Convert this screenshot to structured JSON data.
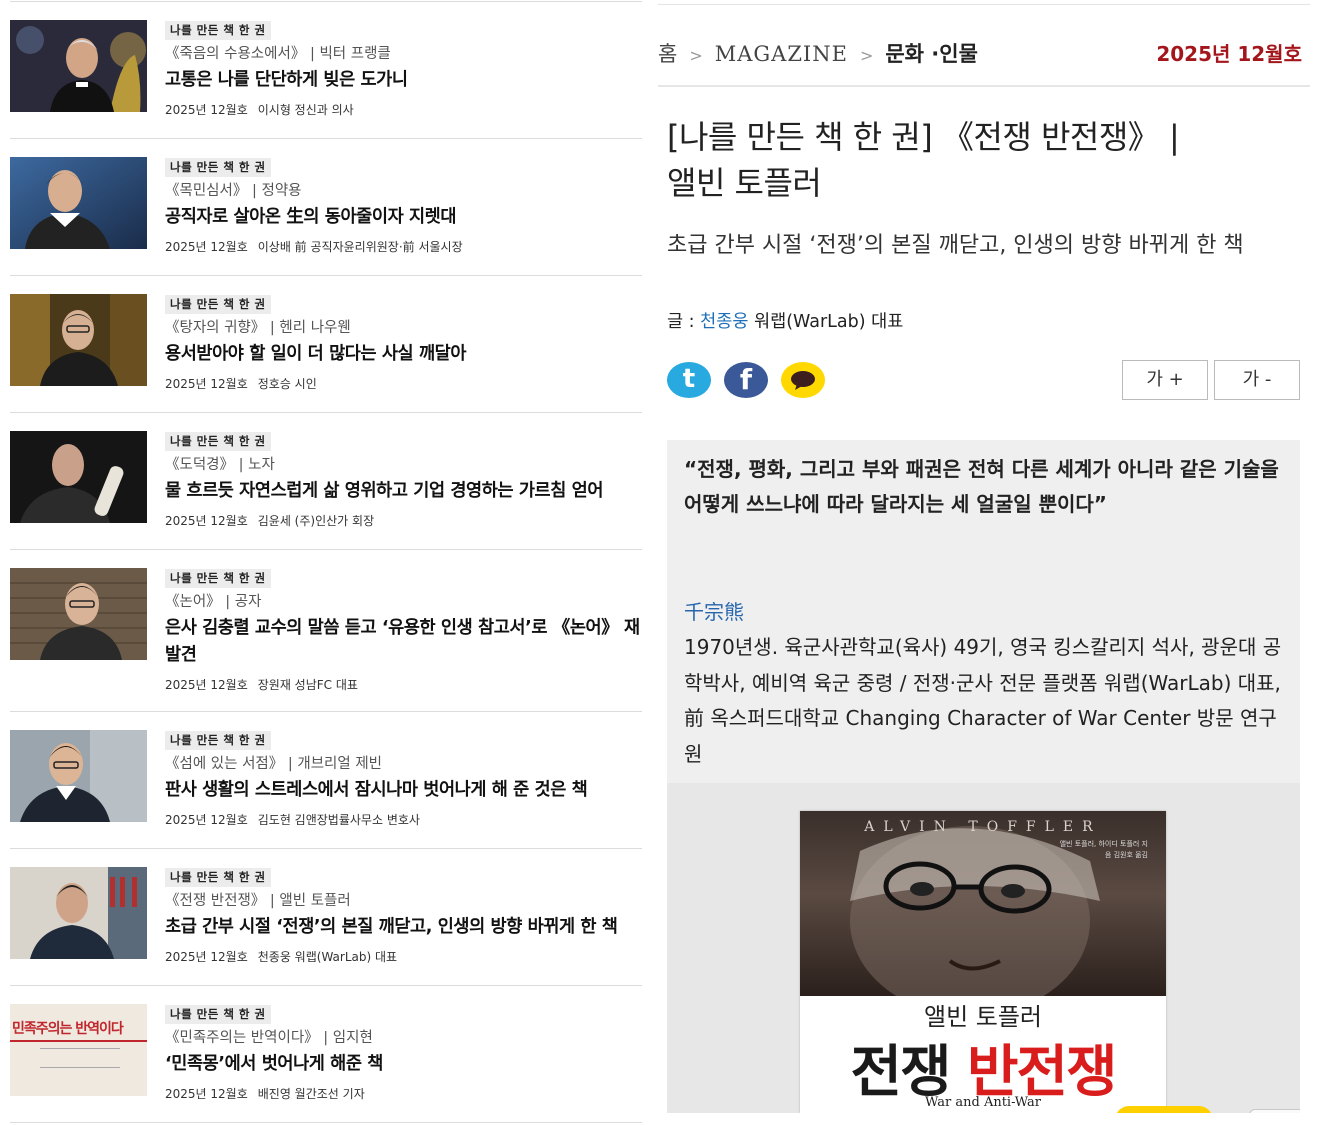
{
  "list": {
    "items": [
      {
        "tag": "나를 만든 책 한 권",
        "book": "《죽음의 수용소에서》",
        "book_author": "| 빅터 프랭클",
        "headline": "고통은 나를 단단하게 빚은 도가니",
        "date": "2025년 12월호",
        "author": "이시형 정신과 의사"
      },
      {
        "tag": "나를 만든 책 한 권",
        "book": "《목민심서》",
        "book_author": "| 정약용",
        "headline": "공직자로 살아온 生의 동아줄이자 지렛대",
        "date": "2025년 12월호",
        "author": "이상배 前 공직자윤리위원장·前 서울시장"
      },
      {
        "tag": "나를 만든 책 한 권",
        "book": "《탕자의 귀향》",
        "book_author": "| 헨리 나우웬",
        "headline": "용서받아야 할 일이 더 많다는 사실 깨달아",
        "date": "2025년 12월호",
        "author": "정호승 시인"
      },
      {
        "tag": "나를 만든 책 한 권",
        "book": "《도덕경》",
        "book_author": "| 노자",
        "headline": "물 흐르듯 자연스럽게 삶 영위하고 기업 경영하는 가르침 얻어",
        "date": "2025년 12월호",
        "author": "김윤세 (주)인산가 회장"
      },
      {
        "tag": "나를 만든 책 한 권",
        "book": "《논어》",
        "book_author": "| 공자",
        "headline": "은사 김충렬 교수의 말씀 듣고 ‘유용한 인생 참고서’로 《논어》 재발견",
        "date": "2025년 12월호",
        "author": "장원재 성남FC 대표"
      },
      {
        "tag": "나를 만든 책 한 권",
        "book": "《섬에 있는 서점》",
        "book_author": "| 개브리얼 제빈",
        "headline": "판사 생활의 스트레스에서 잠시나마 벗어나게 해 준 것은 책",
        "date": "2025년 12월호",
        "author": "김도현 김앤장법률사무소 변호사"
      },
      {
        "tag": "나를 만든 책 한 권",
        "book": "《전쟁 반전쟁》",
        "book_author": "| 앨빈 토플러",
        "headline": "초급 간부 시절 ‘전쟁’의 본질 깨닫고, 인생의 방향 바뀌게 한 책",
        "date": "2025년 12월호",
        "author": "천종웅 워랩(WarLab) 대표"
      },
      {
        "tag": "나를 만든 책 한 권",
        "book": "《민족주의는 반역이다》",
        "book_author": "| 임지현",
        "headline": "‘민족몽’에서 벗어나게 해준 책",
        "date": "2025년 12월호",
        "author": "배진영 월간조선 기자"
      }
    ],
    "thumb_text_8": "민족주의는 반역이다"
  },
  "article": {
    "breadcrumb": {
      "home": "홈",
      "magazine": "MAGAZINE",
      "category": "문화 ·인물"
    },
    "issue": "2025년 12월호",
    "title_line1": "[나를 만든 책 한 권] 《전쟁 반전쟁》 |",
    "title_line2": "앨빈 토플러",
    "subtitle": "초급 간부 시절 ‘전쟁’의 본질 깨닫고, 인생의 방향 바뀌게 한 책",
    "byline_prefix": "글 :",
    "byline_author": "천종웅",
    "byline_role": "워랩(WarLab) 대표",
    "share": {
      "twitter_icon": "twitter-icon",
      "facebook_icon": "facebook-icon",
      "kakao_icon": "kakaotalk-icon"
    },
    "font_larger": "가 +",
    "font_smaller": "가 -",
    "quote": "“전쟁, 평화, 그리고 부와 패권은 전혀 다른 세계가 아니라 같은 기술을 어떻게 쓰느냐에 따라 달라지는 세 얼굴일 뿐이다”",
    "hanja_name": "千宗熊",
    "bio": "1970년생. 육군사관학교(육사) 49기, 영국 킹스칼리지 석사, 광운대 공학박사, 예비역 육군 중령 / 전쟁·군사 전문 플랫폼 워랩(WarLab) 대표, 前 옥스퍼드대학교 Changing Character of War Center 방문 연구원",
    "book_cover": {
      "name": "ALVIN TOFFLER",
      "small": "앨빈 토플러, 하이디 토플러 지음 김원호 옮김",
      "author": "앨빈 토플러",
      "title_a": "전쟁",
      "title_b": "반전쟁",
      "subtitle": "War and Anti-War"
    }
  },
  "colors": {
    "accent_red": "#a3161c",
    "link_blue": "#1c6fb8",
    "twitter": "#1da1f2",
    "facebook": "#3b5998",
    "kakao": "#ffd400"
  }
}
